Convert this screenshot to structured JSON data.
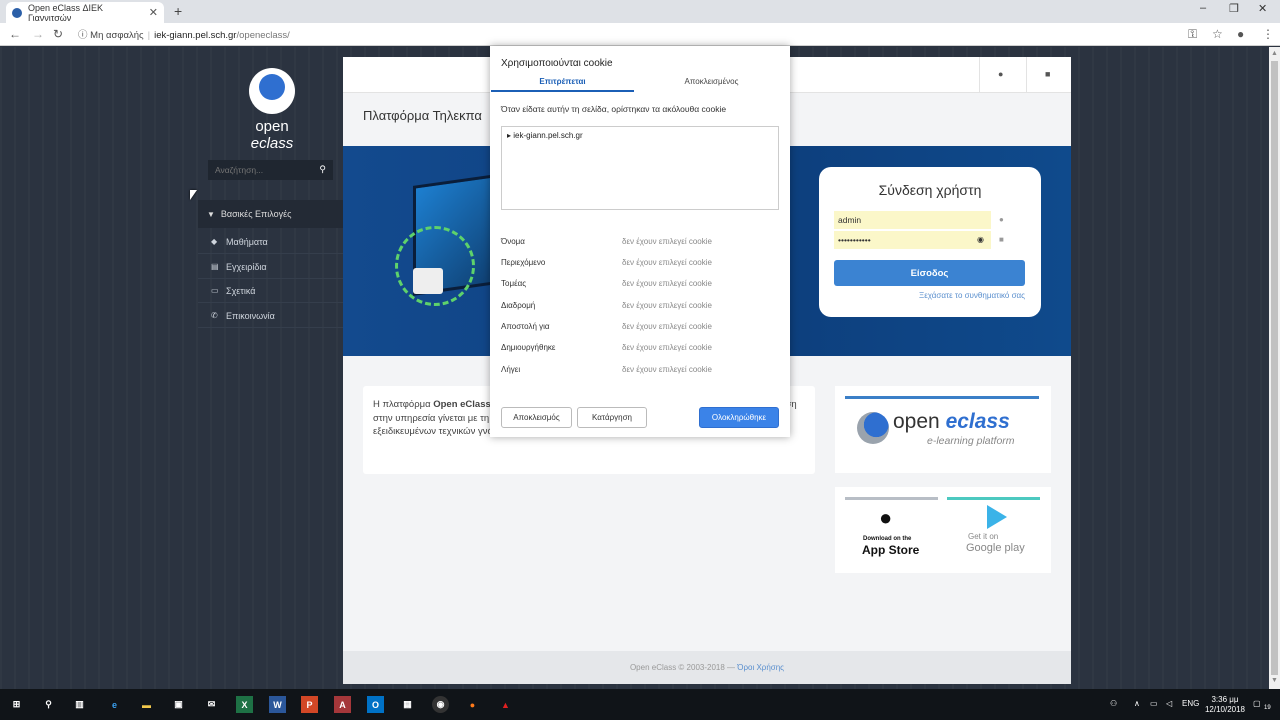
{
  "browser": {
    "tab_title": "Open eClass ΔΙΕΚ Γιαννιτσών",
    "insecure_label": "Μη ασφαλής",
    "url_host": "iek-giann.pel.sch.gr",
    "url_path": "/openeclass/"
  },
  "sidebar": {
    "logo_text_1": "open ",
    "logo_text_2": "eclass",
    "search_placeholder": "Αναζήτηση...",
    "section_title": "Βασικές Επιλογές",
    "items": [
      {
        "label": "Μαθήματα",
        "icon": "graduation-cap-icon"
      },
      {
        "label": "Εγχειρίδια",
        "icon": "book-icon"
      },
      {
        "label": "Σχετικά",
        "icon": "card-icon"
      },
      {
        "label": "Επικοινωνία",
        "icon": "phone-icon"
      }
    ]
  },
  "main": {
    "platform_title": "Πλατφόρμα Τηλεκπα",
    "login": {
      "title": "Σύνδεση χρήστη",
      "username": "admin",
      "password": "•••••••••••",
      "button": "Είσοδος",
      "forgot": "Ξεχάσατε το συνθηματικό σας"
    },
    "intro": {
      "pre": "Η πλατφόρμα ",
      "bold": "Open eClass",
      "post": " ... Ηλεκτρονικών Μαθημάτων ... υποστηρίζει την υπηρεσία ... πρόσβαση στην υπηρεσία γίνεται με τη χρήση ενός απλού φυλλομετρητή (web browser) χωρίς την απαίτηση εξειδικευμένων τεχνικών γνώσεων."
    },
    "promo": {
      "brand_1": "open ",
      "brand_2": "eclass",
      "brand_sub": "e-learning platform",
      "appstore_small": "Download on the",
      "appstore_big": "App Store",
      "gplay_small": "Get it on",
      "gplay_big": "Google play"
    },
    "footer_text": "Open eClass © 2003-2018 — ",
    "footer_link": "Όροι Χρήσης"
  },
  "cookie_dialog": {
    "title": "Χρησιμοποιούνται cookie",
    "tab_allowed": "Επιτρέπεται",
    "tab_blocked": "Αποκλεισμένος",
    "description": "Όταν είδατε αυτήν τη σελίδα, ορίστηκαν τα ακόλουθα cookie",
    "tree_item": "iek-giann.pel.sch.gr",
    "fields": [
      {
        "key": "Όνομα",
        "value": "δεν έχουν επιλεγεί cookie"
      },
      {
        "key": "Περιεχόμενο",
        "value": "δεν έχουν επιλεγεί cookie"
      },
      {
        "key": "Τομέας",
        "value": "δεν έχουν επιλεγεί cookie"
      },
      {
        "key": "Διαδρομή",
        "value": "δεν έχουν επιλεγεί cookie"
      },
      {
        "key": "Αποστολή για",
        "value": "δεν έχουν επιλεγεί cookie"
      },
      {
        "key": "Δημιουργήθηκε",
        "value": "δεν έχουν επιλεγεί cookie"
      },
      {
        "key": "Λήγει",
        "value": "δεν έχουν επιλεγεί cookie"
      }
    ],
    "btn_block": "Αποκλεισμός",
    "btn_remove": "Κατάργηση",
    "btn_done": "Ολοκληρώθηκε"
  },
  "taskbar": {
    "time": "3:36 μμ",
    "date": "12/10/2018",
    "lang": "ENG",
    "notif_count": "19"
  },
  "colors": {
    "accent": "#3b83d2",
    "sidebar_bg": "#2b3340",
    "hero_bg": "#134a8e"
  }
}
